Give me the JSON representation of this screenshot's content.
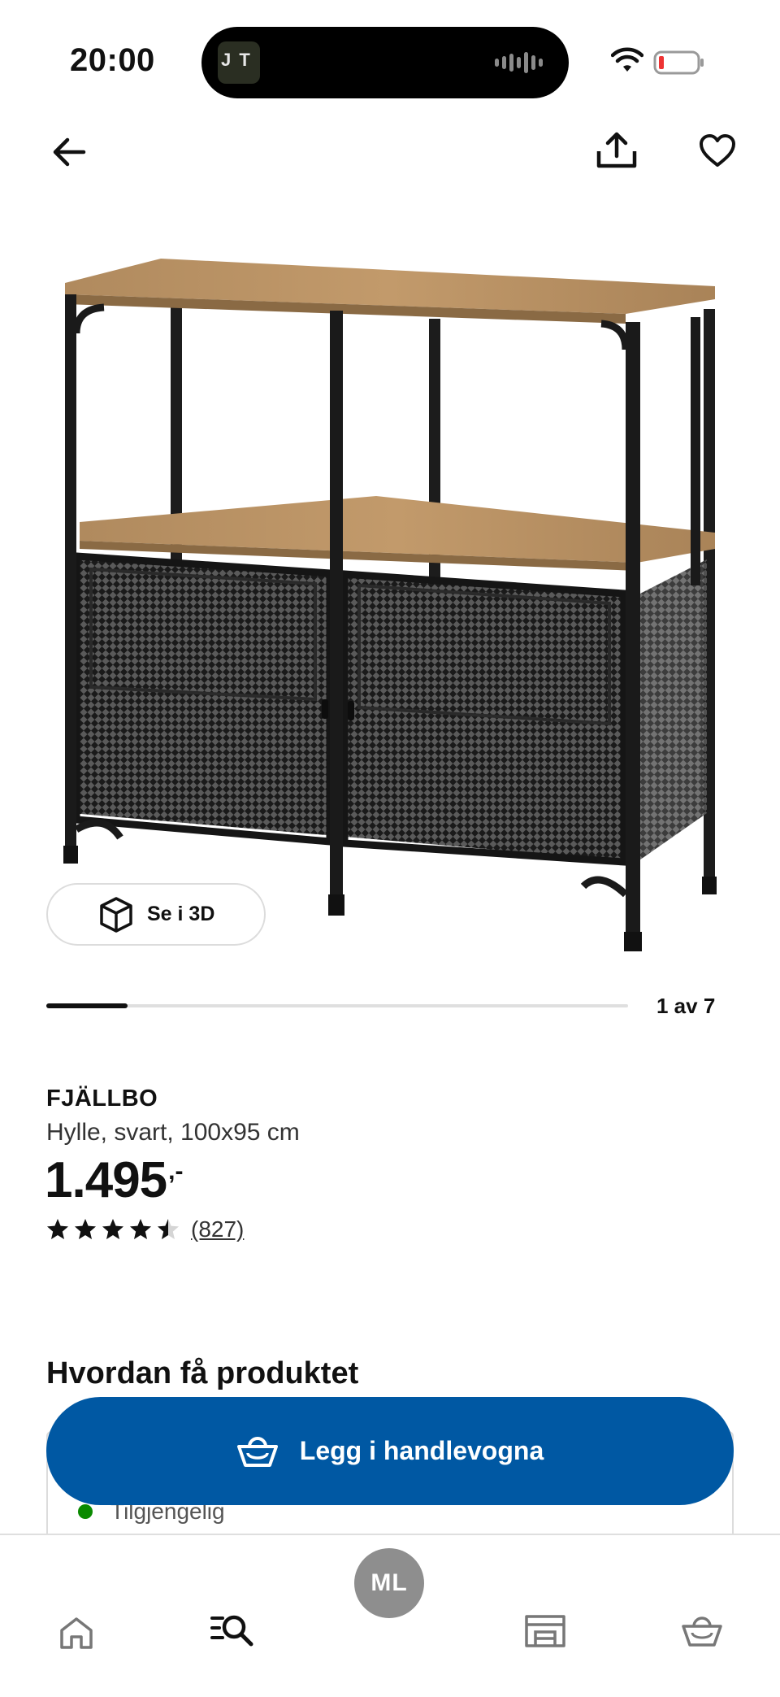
{
  "status_bar": {
    "time": "20:00",
    "island_thumb_text": "J T"
  },
  "product": {
    "name": "FJÄLLBO",
    "description": "Hylle, svart, 100x95 cm",
    "price": "1.495",
    "price_suffix": ",-",
    "rating": 4.5,
    "review_count": "(827)",
    "view_3d_label": "Se i 3D",
    "image_counter": "1 av 7",
    "image_progress": 0.14
  },
  "how_to_get": {
    "heading": "Hvordan få produktet",
    "availability": "Tilgjengelig",
    "availability_color": "#0a8a00"
  },
  "cart": {
    "button_label": "Legg i handlevogna",
    "button_color": "#0058a3"
  },
  "bottom_nav": {
    "profile_initials": "ML",
    "items": [
      "home-icon",
      "search-list-icon",
      "profile-avatar",
      "store-icon",
      "basket-icon"
    ]
  }
}
